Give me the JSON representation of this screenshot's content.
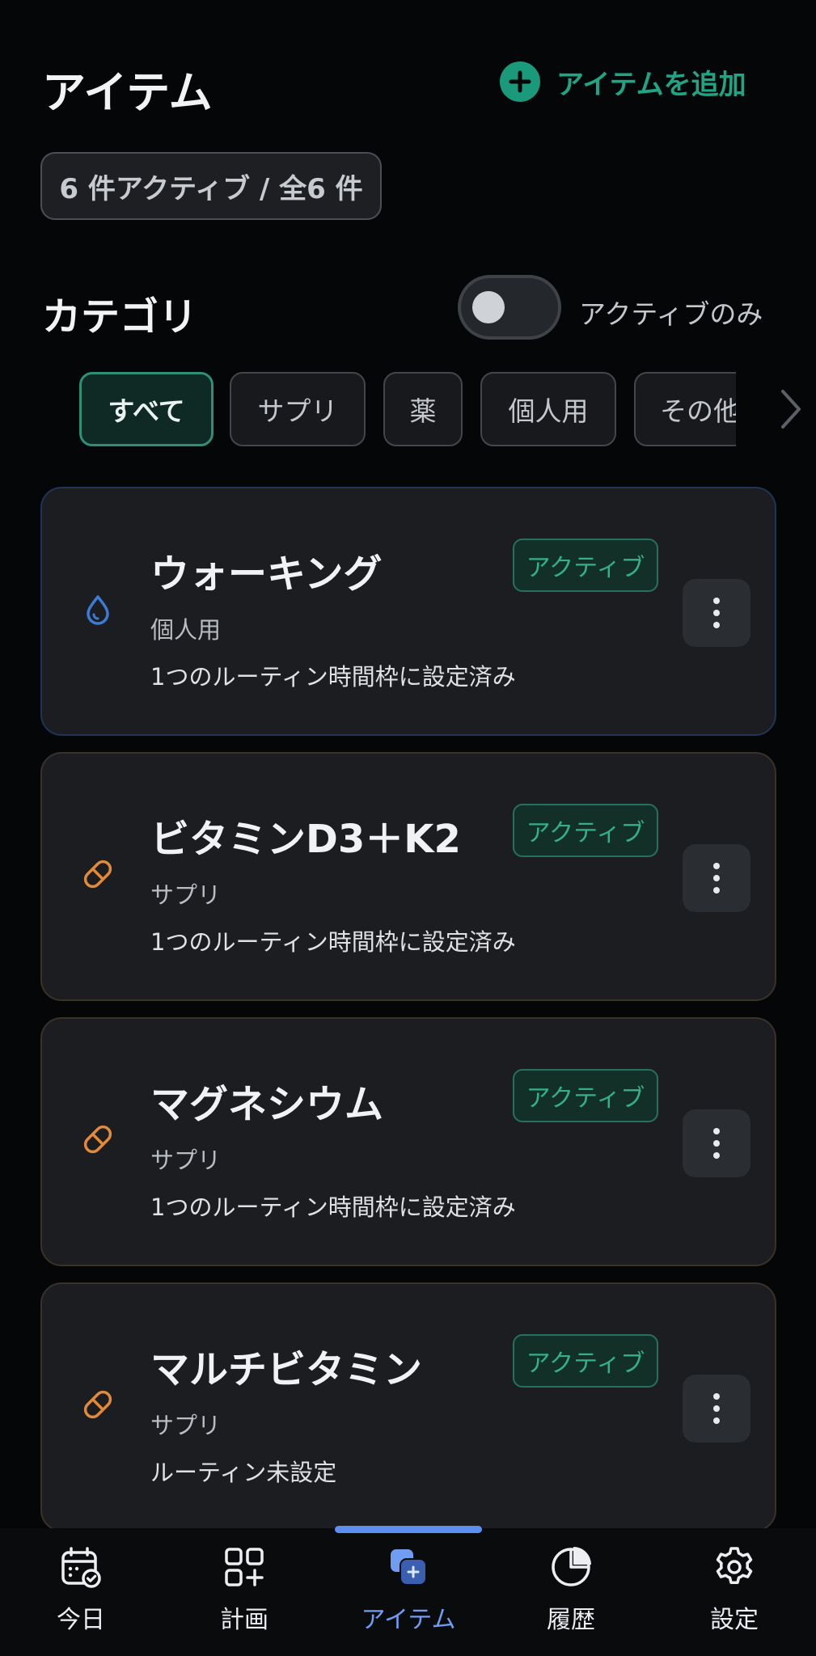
{
  "header": {
    "title": "アイテム",
    "add_label": "アイテムを追加",
    "count_label": "6 件アクティブ / 全6 件"
  },
  "category": {
    "title": "カテゴリ",
    "active_only_label": "アクティブのみ",
    "active_only_on": false,
    "chips": [
      {
        "label": "すべて",
        "selected": true
      },
      {
        "label": "サプリ",
        "selected": false
      },
      {
        "label": "薬",
        "selected": false
      },
      {
        "label": "個人用",
        "selected": false
      },
      {
        "label": "その他",
        "selected": false
      }
    ]
  },
  "items": [
    {
      "name": "ウォーキング",
      "category": "個人用",
      "status": "アクティブ",
      "schedule": "1つのルーティン時間枠に設定済み",
      "icon": "water-drop-icon",
      "accent": "#3b7bd6"
    },
    {
      "name": "ビタミンD3＋K2",
      "category": "サプリ",
      "status": "アクティブ",
      "schedule": "1つのルーティン時間枠に設定済み",
      "icon": "pill-icon",
      "accent": "#e08a3c"
    },
    {
      "name": "マグネシウム",
      "category": "サプリ",
      "status": "アクティブ",
      "schedule": "1つのルーティン時間枠に設定済み",
      "icon": "pill-icon",
      "accent": "#e08a3c"
    },
    {
      "name": "マルチビタミン",
      "category": "サプリ",
      "status": "アクティブ",
      "schedule": "ルーティン未設定",
      "icon": "pill-icon",
      "accent": "#e08a3c"
    }
  ],
  "nav": {
    "items": [
      {
        "label": "今日",
        "icon": "calendar-check-icon"
      },
      {
        "label": "計画",
        "icon": "grid-plus-icon"
      },
      {
        "label": "アイテム",
        "icon": "items-icon",
        "active": true
      },
      {
        "label": "履歴",
        "icon": "pie-chart-icon"
      },
      {
        "label": "設定",
        "icon": "gear-icon"
      }
    ]
  },
  "colors": {
    "background": "#050608",
    "accent_green": "#1fa583",
    "nav_active": "#6e9df2"
  }
}
